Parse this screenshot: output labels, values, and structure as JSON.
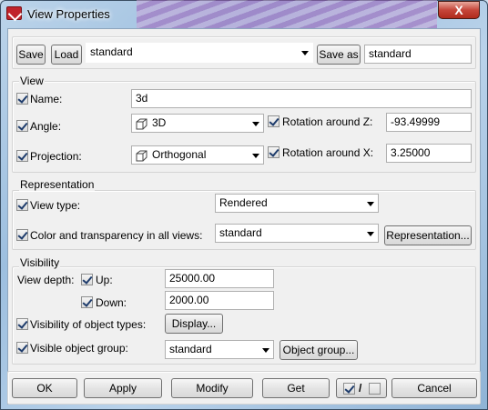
{
  "window": {
    "title": "View Properties",
    "close_glyph": "X"
  },
  "toolbar": {
    "save_label": "Save",
    "load_label": "Load",
    "load_value": "standard",
    "save_as_label": "Save as",
    "save_as_value": "standard"
  },
  "view": {
    "group_label": "View",
    "name_label": "Name:",
    "name_value": "3d",
    "angle_label": "Angle:",
    "angle_value": "3D",
    "projection_label": "Projection:",
    "projection_value": "Orthogonal",
    "rot_z_label": "Rotation around Z:",
    "rot_z_value": "-93.49999",
    "rot_x_label": "Rotation around X:",
    "rot_x_value": "3.25000"
  },
  "representation": {
    "group_label": "Representation",
    "view_type_label": "View type:",
    "view_type_value": "Rendered",
    "color_label": "Color and transparency in all views:",
    "color_value": "standard",
    "rep_button": "Representation..."
  },
  "visibility": {
    "group_label": "Visibility",
    "depth_label": "View depth:",
    "up_label": "Up:",
    "up_value": "25000.00",
    "down_label": "Down:",
    "down_value": "2000.00",
    "obj_types_label": "Visibility of object types:",
    "display_button": "Display...",
    "obj_group_label": "Visible object group:",
    "obj_group_value": "standard",
    "obj_group_button": "Object group..."
  },
  "footer": {
    "ok": "OK",
    "apply": "Apply",
    "modify": "Modify",
    "get": "Get",
    "toggle_sep": "/",
    "cancel": "Cancel"
  }
}
